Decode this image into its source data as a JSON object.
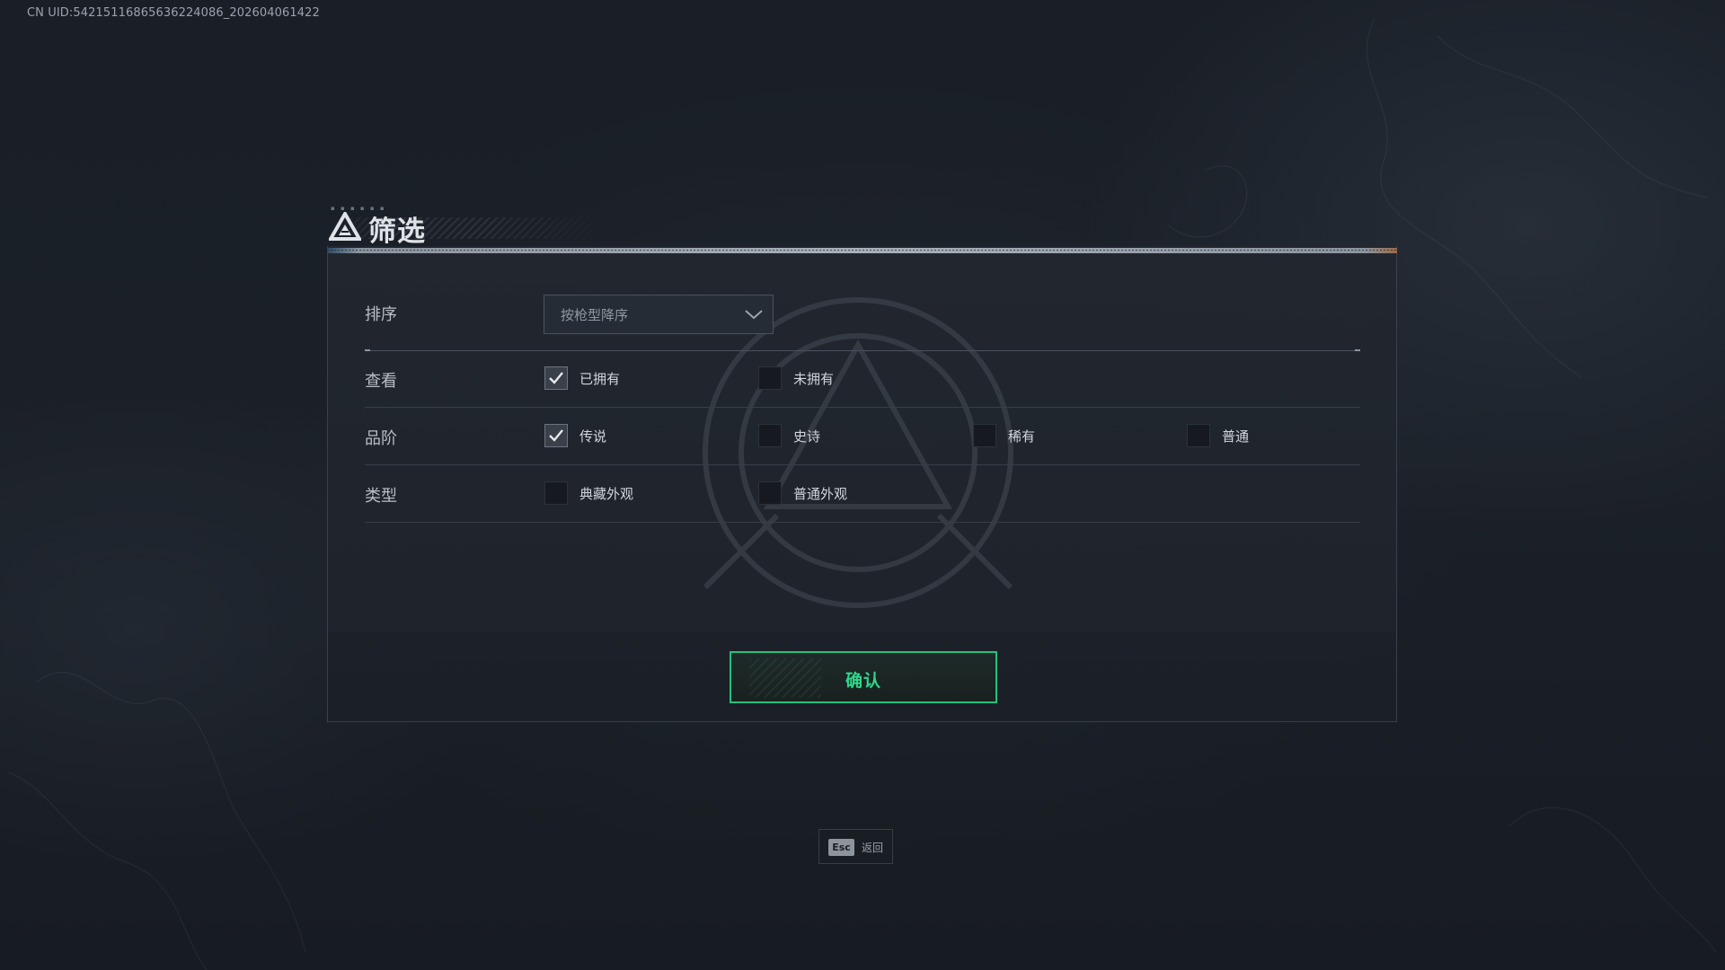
{
  "uid_text": "CN UID:542151168656362240​86_202604061422",
  "header": {
    "title": "筛选",
    "icon": "triangle-logo-icon"
  },
  "sort": {
    "label": "排序",
    "selected": "按枪型降序",
    "icon": "chevron-down-icon"
  },
  "view": {
    "label": "查看",
    "options": [
      {
        "label": "已拥有",
        "checked": true
      },
      {
        "label": "未拥有",
        "checked": false
      }
    ]
  },
  "rarity": {
    "label": "品阶",
    "options": [
      {
        "label": "传说",
        "checked": true
      },
      {
        "label": "史诗",
        "checked": false
      },
      {
        "label": "稀有",
        "checked": false
      },
      {
        "label": "普通",
        "checked": false
      }
    ]
  },
  "type": {
    "label": "类型",
    "options": [
      {
        "label": "典藏外观",
        "checked": false
      },
      {
        "label": "普通外观",
        "checked": false
      }
    ]
  },
  "confirm_label": "确认",
  "esc": {
    "key": "Esc",
    "label": "返回"
  },
  "colors": {
    "accent": "#2fd88b",
    "background": "#1b2028",
    "panel": "#222730"
  }
}
